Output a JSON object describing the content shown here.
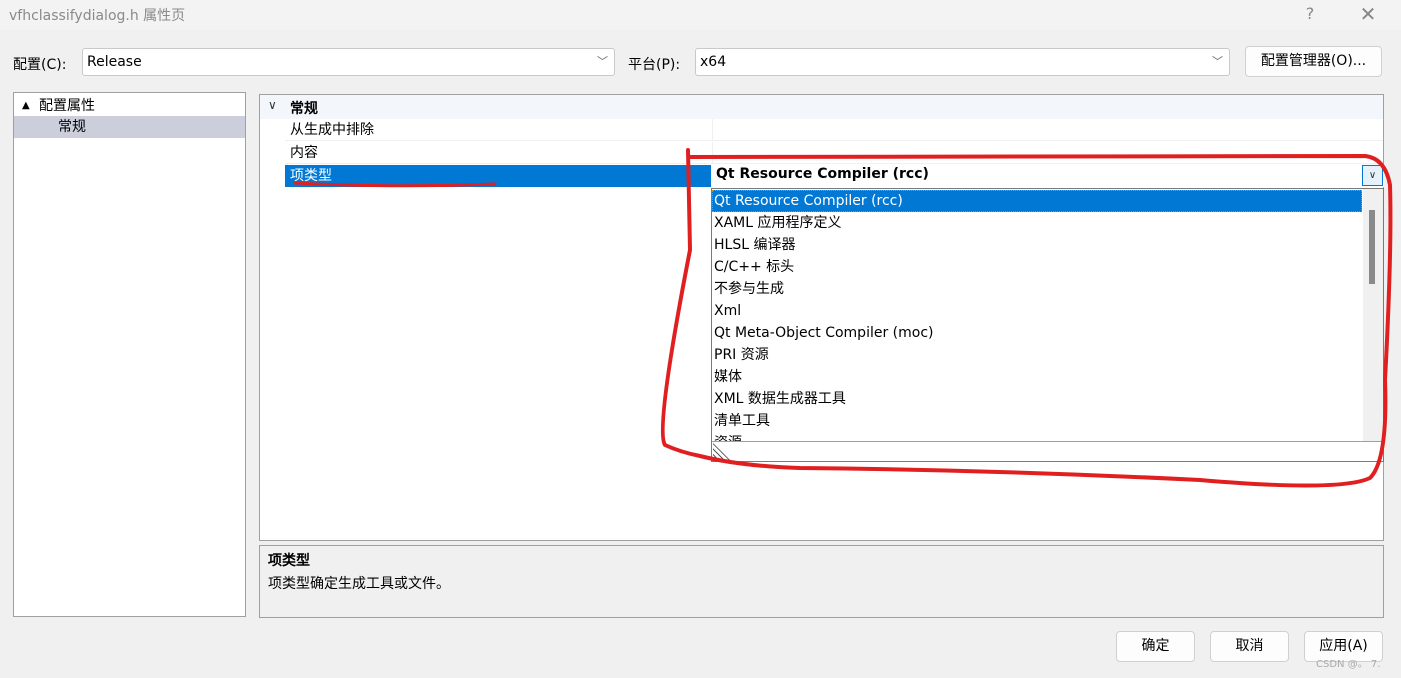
{
  "window": {
    "title": "vfhclassifydialog.h 属性页",
    "help_label": "?",
    "close_label": "✕"
  },
  "toolbar": {
    "config_label": "配置(C):",
    "config_value": "Release",
    "platform_label": "平台(P):",
    "platform_value": "x64",
    "config_manager_label": "配置管理器(O)...",
    "chevron": "﹀"
  },
  "tree": {
    "root_label": "配置属性",
    "root_icon": "▲",
    "items": [
      {
        "label": "常规"
      }
    ]
  },
  "grid": {
    "category_label": "常规",
    "category_chevron": "∨",
    "properties": [
      {
        "name": "从生成中排除",
        "value": ""
      },
      {
        "name": "内容",
        "value": ""
      },
      {
        "name": "项类型",
        "value": "Qt Resource Compiler (rcc)"
      }
    ]
  },
  "dropdown": {
    "button_glyph": "∨",
    "options": [
      "Qt Resource Compiler (rcc)",
      "XAML 应用程序定义",
      "HLSL 编译器",
      "C/C++ 标头",
      "不参与生成",
      "Xml",
      "Qt Meta-Object Compiler (moc)",
      "PRI 资源",
      "媒体",
      "XML 数据生成器工具",
      "清单工具",
      "资源"
    ],
    "selected_index": 0,
    "scroll_fraction": 0.0
  },
  "description": {
    "title": "项类型",
    "text": "项类型确定生成工具或文件。"
  },
  "footer": {
    "ok_label": "确定",
    "cancel_label": "取消",
    "apply_label": "应用(A)"
  },
  "watermark": "CSDN @。 7.",
  "annotation_color": "#e02020",
  "accent_color": "#0078d4"
}
